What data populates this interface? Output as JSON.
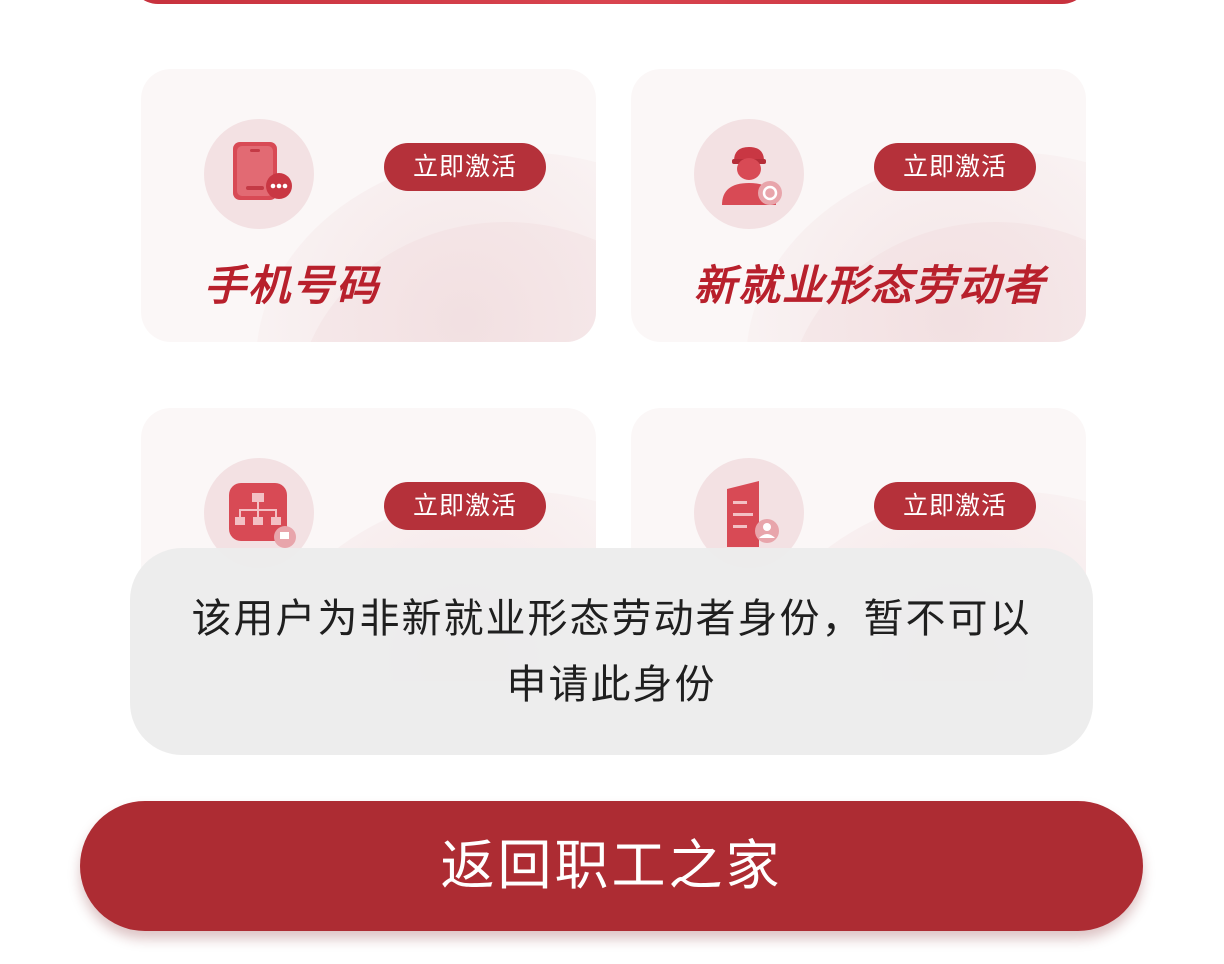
{
  "cards": [
    {
      "title": "手机号码",
      "button_label": "立即激活",
      "icon": "phone-tablet-icon"
    },
    {
      "title": "新就业形态劳动者",
      "button_label": "立即激活",
      "icon": "worker-person-icon"
    },
    {
      "title": "",
      "button_label": "立即激活",
      "icon": "org-chart-icon"
    },
    {
      "title": "",
      "button_label": "立即激活",
      "icon": "enterprise-building-icon"
    }
  ],
  "toast": {
    "message": "该用户为非新就业形态劳动者身份，暂不可以申请此身份"
  },
  "footer": {
    "home_button_label": "返回职工之家"
  },
  "colors": {
    "brand_red": "#ad2c33",
    "title_red": "#b8202c",
    "card_bg": "#fbf7f7",
    "toast_bg": "#ececec"
  }
}
